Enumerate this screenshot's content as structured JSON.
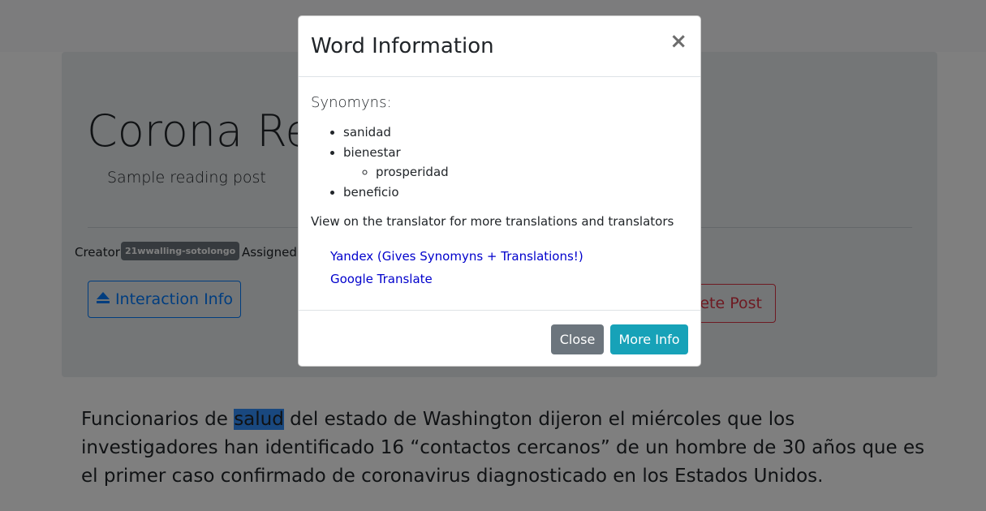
{
  "post": {
    "title": "Corona Reading",
    "subtitle": "Sample reading post",
    "creator_label": "Creator",
    "creator_badge": "21wwalling-sotolongo",
    "assigned_label": "Assigned",
    "interaction_button": "Interaction Info",
    "delete_button": "Delete Post",
    "body_before": "Funcionarios de ",
    "body_highlight": "salud",
    "body_after": " del estado de Washington dijeron el miércoles que los investigadores han identificado 16 “contactos cercanos” de un hombre de 30 años que es el primer caso confirmado de coronavirus diagnosticado en los Estados Unidos."
  },
  "modal": {
    "title": "Word Information",
    "close_symbol": "×",
    "synonyms_heading": "Synomyns:",
    "synonyms": [
      "sanidad",
      "bienestar",
      "prosperidad",
      "beneficio"
    ],
    "view_note": "View on the translator for more translations and translators",
    "links": [
      "Yandex (Gives Synomyns + Translations!)",
      "Google Translate"
    ],
    "close_button": "Close",
    "more_info_button": "More Info"
  },
  "colors": {
    "primary": "#007bff",
    "danger": "#dc3545",
    "secondary": "#6c757d",
    "info": "#17a2b8",
    "link": "#0000cc"
  }
}
